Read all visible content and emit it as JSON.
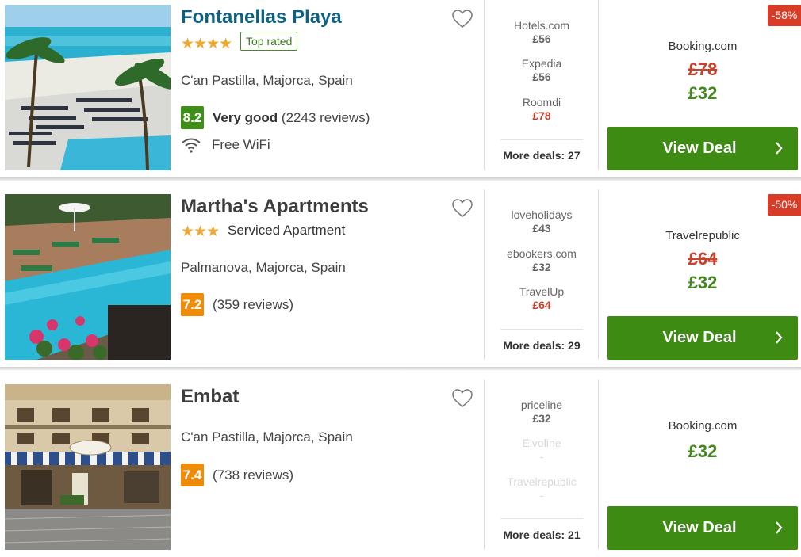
{
  "colors": {
    "brand_link": "#0e6281",
    "deal_green": "#3e8b14",
    "price_green": "#44891f",
    "strike_red": "#c8412c",
    "discount_red": "#d83c27",
    "rating_green": "#3e8e1a",
    "rating_orange": "#f08b08",
    "star_gold": "#f0a832"
  },
  "hotels": [
    {
      "name": "Fontanellas Playa",
      "stars": "★★★★",
      "star_count": 4,
      "top_rated": "Top rated",
      "location": "C'an Pastilla, Majorca, Spain",
      "rating_score": "8.2",
      "rating_label": "Very good",
      "reviews": "(2243 reviews)",
      "amenity": "Free WiFi",
      "amenity_icon": "wifi-icon",
      "deals": [
        {
          "provider": "Hotels.com",
          "price": "£56"
        },
        {
          "provider": "Expedia",
          "price": "£56"
        },
        {
          "provider": "Roomdi",
          "price": "£78"
        }
      ],
      "more_deals": "More deals: 27",
      "discount": "-58%",
      "best_provider": "Booking.com",
      "old_price": "£78",
      "new_price": "£32",
      "button": "View Deal"
    },
    {
      "name": "Martha's Apartments",
      "stars": "★★★",
      "star_count": 3,
      "stay_type": "Serviced Apartment",
      "location": "Palmanova, Majorca, Spain",
      "rating_score": "7.2",
      "reviews": "(359 reviews)",
      "deals": [
        {
          "provider": "loveholidays",
          "price": "£43"
        },
        {
          "provider": "ebookers.com",
          "price": "£32"
        },
        {
          "provider": "TravelUp",
          "price": "£64"
        }
      ],
      "more_deals": "More deals: 29",
      "discount": "-50%",
      "best_provider": "Travelrepublic",
      "old_price": "£64",
      "new_price": "£32",
      "button": "View Deal"
    },
    {
      "name": "Embat",
      "location": "C'an Pastilla, Majorca, Spain",
      "rating_score": "7.4",
      "reviews": "(738 reviews)",
      "deals": [
        {
          "provider": "priceline",
          "price": "£32"
        },
        {
          "provider": "Elvoline",
          "price": "-"
        },
        {
          "provider": "Travelrepublic",
          "price": "-"
        }
      ],
      "more_deals": "More deals: 21",
      "best_provider": "Booking.com",
      "new_price": "£32",
      "button": "View Deal"
    }
  ]
}
